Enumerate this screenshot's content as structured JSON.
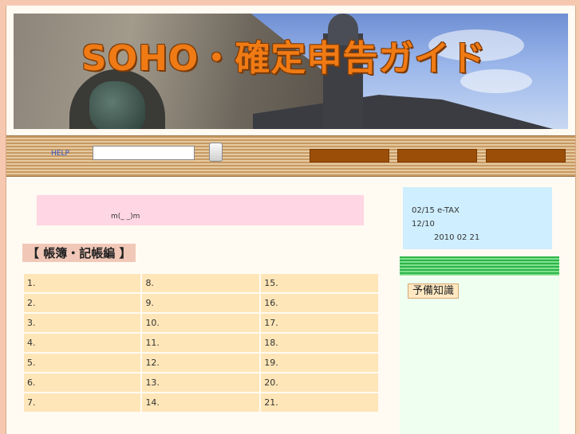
{
  "header": {
    "site_title": "SOHO・確定申告ガイド"
  },
  "navbar": {
    "help_label": "HELP",
    "search_value": ""
  },
  "notice": {
    "text": "m(_ _)m"
  },
  "section": {
    "heading": "【 帳簿・記帳編 】"
  },
  "toc": {
    "rows": [
      [
        "1.",
        "8.",
        "15."
      ],
      [
        "2.",
        "9.",
        "16."
      ],
      [
        "3.",
        "10.",
        "17."
      ],
      [
        "4.",
        "11.",
        "18."
      ],
      [
        "5.",
        "12.",
        "19."
      ],
      [
        "6.",
        "13.",
        "20."
      ],
      [
        "7.",
        "14.",
        "21."
      ]
    ]
  },
  "sidebar": {
    "news": [
      "02/15 e-TAX",
      "12/10",
      "2010 02 21"
    ],
    "knowledge_label": "予備知識"
  },
  "colors": {
    "nav_button": "#9a4e08",
    "title": "#f07a14",
    "notice_bg": "#ffd6e4",
    "toc_cell": "#ffe6b8",
    "news_bg": "#cfeeff",
    "green_bar": "#2fb54a"
  }
}
